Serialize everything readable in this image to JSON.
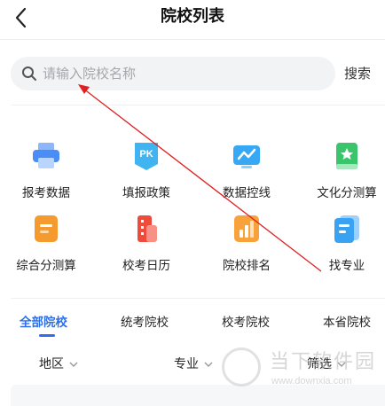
{
  "header": {
    "title": "院校列表",
    "back_icon": "chevron-left-icon"
  },
  "search": {
    "placeholder": "请输入院校名称",
    "button_label": "搜索",
    "icon": "search-icon"
  },
  "grid": {
    "row1": [
      {
        "label": "报考数据",
        "icon": "printer-icon",
        "color": "#4a8df6"
      },
      {
        "label": "填报政策",
        "icon": "pk-badge-icon",
        "color": "#3fb4f0"
      },
      {
        "label": "数据控线",
        "icon": "trend-board-icon",
        "color": "#36a8f5"
      },
      {
        "label": "文化分测算",
        "icon": "star-book-icon",
        "color": "#38c56b"
      }
    ],
    "row2": [
      {
        "label": "综合分测算",
        "icon": "document-icon",
        "color": "#f59a2f"
      },
      {
        "label": "校考日历",
        "icon": "building-icon",
        "color": "#ef4b3c"
      },
      {
        "label": "院校排名",
        "icon": "bar-chart-icon",
        "color": "#f7a23a"
      },
      {
        "label": "找专业",
        "icon": "notebook-icon",
        "color": "#3aa2f3"
      }
    ]
  },
  "tabs": [
    {
      "label": "全部院校",
      "active": true
    },
    {
      "label": "统考院校",
      "active": false
    },
    {
      "label": "校考院校",
      "active": false
    },
    {
      "label": "本省院校",
      "active": false
    }
  ],
  "filters": [
    {
      "label": "地区"
    },
    {
      "label": "专业"
    },
    {
      "label": "筛选"
    }
  ],
  "watermark": {
    "text": "当下软件园",
    "url": "www.downxia.com"
  },
  "colors": {
    "accent": "#2c6fe8",
    "annotation_arrow": "#e02020"
  }
}
